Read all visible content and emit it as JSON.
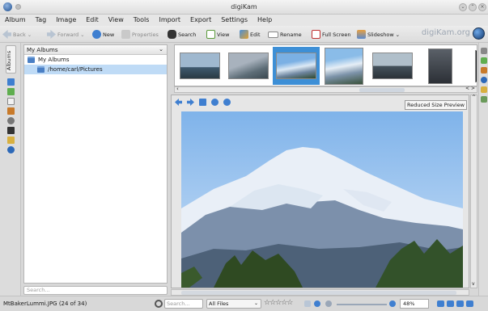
{
  "window": {
    "title": "digiKam"
  },
  "menubar": [
    "Album",
    "Tag",
    "Image",
    "Edit",
    "View",
    "Tools",
    "Import",
    "Export",
    "Settings",
    "Help"
  ],
  "toolbar": {
    "back": "Back",
    "forward": "Forward",
    "new": "New",
    "properties": "Properties",
    "search": "Search",
    "view": "View",
    "edit": "Edit",
    "rename": "Rename",
    "fullscreen": "Full Screen",
    "slideshow": "Slideshow",
    "brand": "digiKam.org"
  },
  "left_sidebar": {
    "tab_label": "Albums"
  },
  "album_panel": {
    "header": "My Albums",
    "tree": [
      "My Albums",
      "/home/carl/Pictures"
    ],
    "search_placeholder": "Search..."
  },
  "filmstrip": {
    "thumbs": [
      {
        "name": "lake-sunset",
        "colors": [
          "#9fb8cf",
          "#3f5a6f"
        ]
      },
      {
        "name": "mountain-overcast",
        "colors": [
          "#a8b2bd",
          "#5e6e78"
        ]
      },
      {
        "name": "mountain-blue",
        "colors": [
          "#7bb0e4",
          "#dce9f5"
        ]
      },
      {
        "name": "mountain-clear",
        "colors": [
          "#8abce8",
          "#e6eef6"
        ]
      },
      {
        "name": "lake-evening",
        "colors": [
          "#b0bfca",
          "#45525c"
        ]
      },
      {
        "name": "dark-forest",
        "colors": [
          "#5a6068",
          "#2c3036"
        ]
      },
      {
        "name": "partial",
        "colors": [
          "#3a3c40",
          "#202226"
        ]
      }
    ],
    "selected_index": 2
  },
  "viewer": {
    "badge": "Reduced Size Preview"
  },
  "statusbar": {
    "file": "MtBakerLummi.JPG (24 of 34)",
    "search_placeholder": "Search...",
    "filter": "All Files",
    "stars": "☆☆☆☆☆",
    "zoom": "48%"
  },
  "colors": {
    "selection": "#3d8fd6",
    "tree_selection": "#bfdbf6"
  }
}
